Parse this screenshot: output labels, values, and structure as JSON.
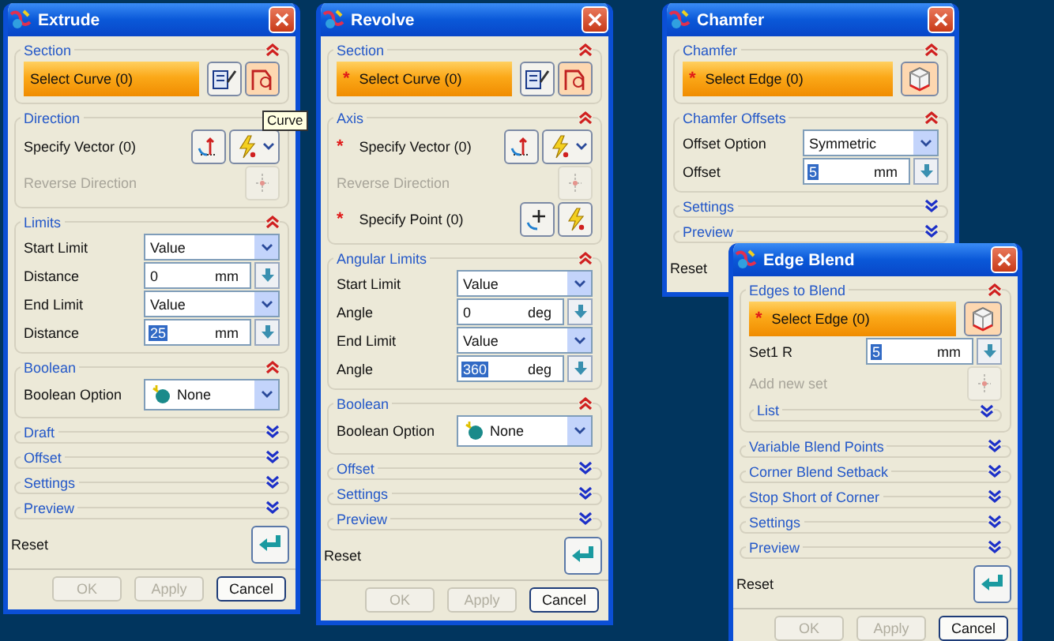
{
  "dialogs": [
    {
      "title": "Extrude",
      "tooltip": "Curve",
      "sections": [
        {
          "title": "Section",
          "expanded": true,
          "rows": [
            {
              "kind": "curve",
              "label": "Select Curve (0)"
            }
          ]
        },
        {
          "title": "Direction",
          "expanded": true,
          "rows": [
            {
              "kind": "vector",
              "label": "Specify Vector (0)"
            },
            {
              "kind": "toggle",
              "label": "Reverse Direction",
              "disabled": true
            }
          ]
        },
        {
          "title": "Limits",
          "expanded": true,
          "rows": [
            {
              "kind": "dropdown",
              "label": "Start Limit",
              "value": "Value"
            },
            {
              "kind": "value",
              "label": "Distance",
              "value": "0",
              "unit": "mm",
              "selected": false
            },
            {
              "kind": "dropdown",
              "label": "End Limit",
              "value": "Value"
            },
            {
              "kind": "value",
              "label": "Distance",
              "value": "25",
              "unit": "mm",
              "selected": true
            }
          ]
        },
        {
          "title": "Boolean",
          "expanded": true,
          "rows": [
            {
              "kind": "operation",
              "label": "Boolean Option",
              "value": "None"
            }
          ]
        },
        {
          "title": "Draft",
          "expanded": false
        },
        {
          "title": "Offset",
          "expanded": false
        },
        {
          "title": "Settings",
          "expanded": false
        },
        {
          "title": "Preview",
          "expanded": false
        }
      ],
      "footer": {
        "reset": "Reset",
        "buttons": [
          {
            "label": "OK",
            "disabled": true
          },
          {
            "label": "Apply",
            "disabled": true
          },
          {
            "label": "Cancel",
            "disabled": false
          }
        ]
      }
    },
    {
      "title": "Revolve",
      "sections": [
        {
          "title": "Section",
          "expanded": true,
          "rows": [
            {
              "kind": "curve",
              "label": "Select Curve (0)",
              "marker": "*"
            }
          ]
        },
        {
          "title": "Axis",
          "expanded": true,
          "rows": [
            {
              "kind": "vector",
              "label": "Specify Vector (0)",
              "marker": "*"
            },
            {
              "kind": "toggle",
              "label": "Reverse Direction",
              "disabled": true
            },
            {
              "kind": "point",
              "label": "Specify Point (0)",
              "marker": "*"
            }
          ]
        },
        {
          "title": "Angular Limits",
          "expanded": true,
          "rows": [
            {
              "kind": "dropdown",
              "label": "Start Limit",
              "value": "Value"
            },
            {
              "kind": "value",
              "label": "Angle",
              "value": "0",
              "unit": "deg",
              "selected": false
            },
            {
              "kind": "dropdown",
              "label": "End Limit",
              "value": "Value"
            },
            {
              "kind": "value",
              "label": "Angle",
              "value": "360",
              "unit": "deg",
              "selected": true
            }
          ]
        },
        {
          "title": "Boolean",
          "expanded": true,
          "rows": [
            {
              "kind": "operation",
              "label": "Boolean Option",
              "value": "None"
            }
          ]
        },
        {
          "title": "Offset",
          "expanded": false
        },
        {
          "title": "Settings",
          "expanded": false
        },
        {
          "title": "Preview",
          "expanded": false
        }
      ],
      "footer": {
        "reset": "Reset",
        "buttons": [
          {
            "label": "OK",
            "disabled": true
          },
          {
            "label": "Apply",
            "disabled": true
          },
          {
            "label": "Cancel",
            "disabled": false
          }
        ]
      }
    },
    {
      "title": "Chamfer",
      "sections": [
        {
          "title": "Chamfer",
          "expanded": true,
          "rows": [
            {
              "kind": "edge",
              "label": "Select Edge (0)",
              "marker": "*"
            }
          ]
        },
        {
          "title": "Chamfer Offsets",
          "expanded": true,
          "rows": [
            {
              "kind": "dropdown",
              "label": "Offset Option",
              "value": "Symmetric"
            },
            {
              "kind": "value",
              "label": "Offset",
              "value": "5",
              "unit": "mm",
              "selected": true
            }
          ]
        },
        {
          "title": "Settings",
          "expanded": false
        },
        {
          "title": "Preview",
          "expanded": false
        }
      ],
      "footer": {
        "reset": "Reset"
      }
    },
    {
      "title": "Edge Blend",
      "sections": [
        {
          "title": "Edges to Blend",
          "expanded": true,
          "rows": [
            {
              "kind": "edge",
              "label": "Select Edge (0)",
              "marker": "*"
            },
            {
              "kind": "value",
              "label": "Set1 R",
              "value": "5",
              "unit": "mm",
              "selected": true
            },
            {
              "kind": "toggle",
              "label": "Add new set",
              "disabled": true
            },
            {
              "kind": "group",
              "label": "List",
              "expanded": false
            }
          ]
        },
        {
          "title": "Variable Blend Points",
          "expanded": false
        },
        {
          "title": "Corner Blend Setback",
          "expanded": false
        },
        {
          "title": "Stop Short of Corner",
          "expanded": false
        },
        {
          "title": "Settings",
          "expanded": false
        },
        {
          "title": "Preview",
          "expanded": false
        }
      ],
      "footer": {
        "reset": "Reset",
        "buttons": [
          {
            "label": "OK",
            "disabled": true
          },
          {
            "label": "Apply",
            "disabled": true
          },
          {
            "label": "Cancel",
            "disabled": false
          }
        ]
      }
    }
  ]
}
